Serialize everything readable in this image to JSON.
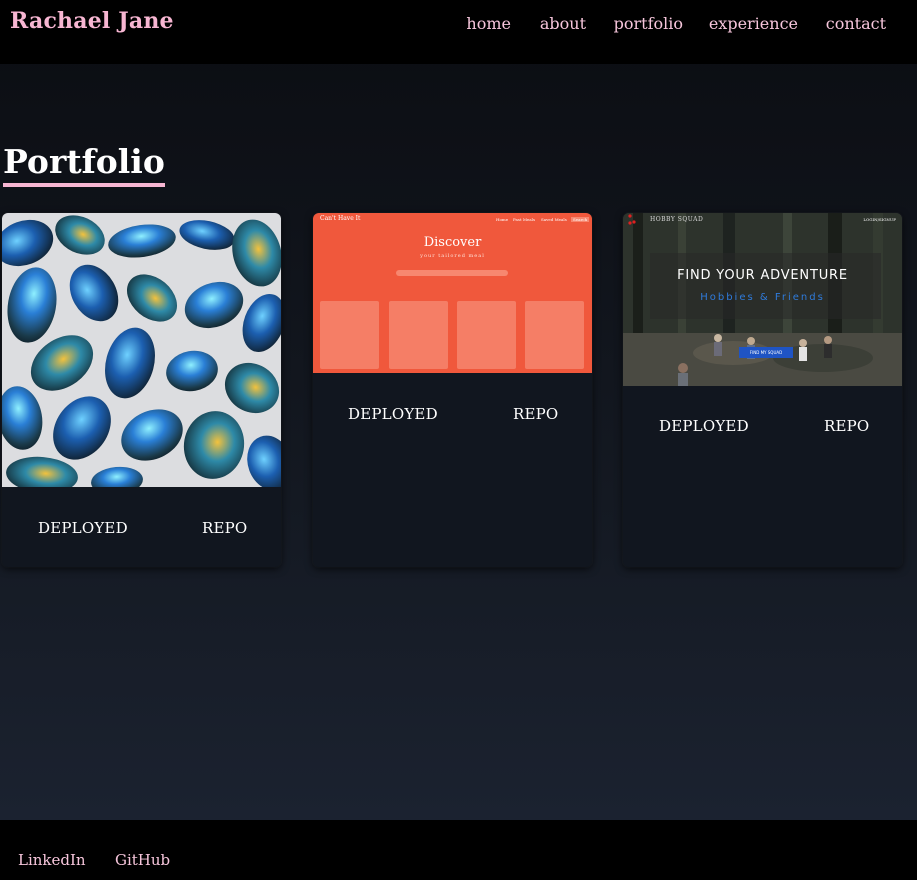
{
  "header": {
    "brand": "Rachael Jane",
    "nav": [
      "home",
      "about",
      "portfolio",
      "experience",
      "contact"
    ]
  },
  "main": {
    "title": "Portfolio",
    "projects": [
      {
        "image": "labradorite-stones-image",
        "deployed_label": "DEPLOYED",
        "repo_label": "REPO"
      },
      {
        "image": "cant-have-it-discover-screenshot",
        "deployed_label": "DEPLOYED",
        "repo_label": "REPO",
        "screenshot": {
          "brand": "Can't Have It",
          "nav": [
            "Home",
            "Past Meals",
            "Saved Meals",
            "Search"
          ],
          "title": "Discover",
          "subtitle": "your tailored meal"
        }
      },
      {
        "image": "hobby-squad-screenshot",
        "deployed_label": "DEPLOYED",
        "repo_label": "REPO",
        "screenshot": {
          "brand": "HOBBY SQUAD",
          "login": "LOGIN/SIGNUP",
          "title": "FIND YOUR ADVENTURE",
          "subtitle": "Hobbies  &  Friends",
          "button": "FIND MY SQUAD"
        }
      }
    ]
  },
  "footer": {
    "links": [
      "LinkedIn",
      "GitHub"
    ]
  },
  "colors": {
    "accent_pink": "#f7b6d2",
    "header_bg": "#000000",
    "card_bg": "#11161f"
  }
}
